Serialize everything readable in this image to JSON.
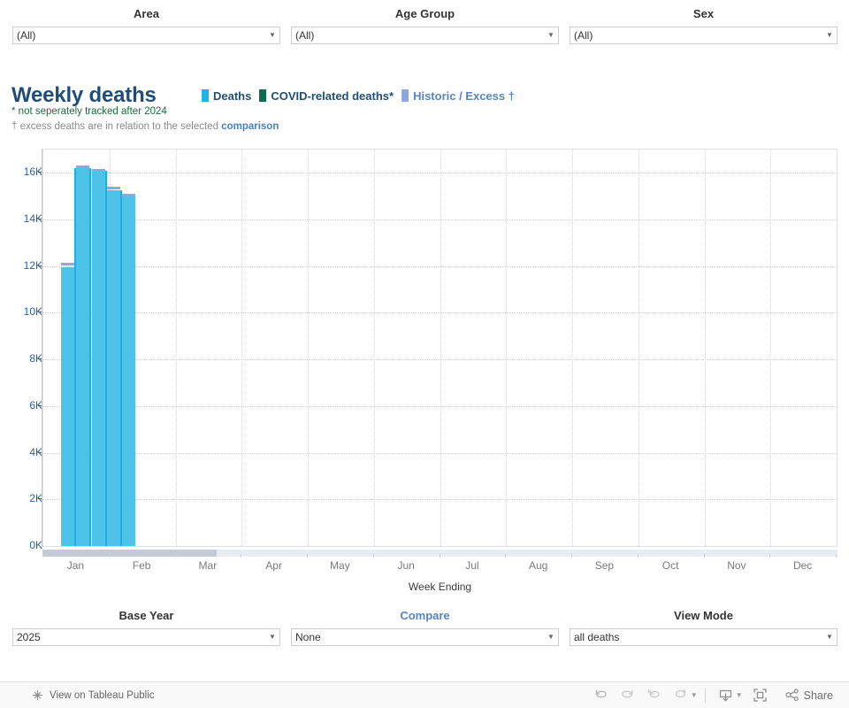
{
  "top_filters": [
    {
      "label": "Area",
      "value": "(All)",
      "label_color": "#333333"
    },
    {
      "label": "Age Group",
      "value": "(All)",
      "label_color": "#333333"
    },
    {
      "label": "Sex",
      "value": "(All)",
      "label_color": "#333333"
    }
  ],
  "bottom_filters": [
    {
      "label": "Base Year",
      "value": "2025",
      "label_color": "#333333"
    },
    {
      "label": "Compare",
      "value": "None",
      "label_color": "#5585c4"
    },
    {
      "label": "View Mode",
      "value": "all deaths",
      "label_color": "#333333"
    }
  ],
  "title": "Weekly deaths",
  "legend": [
    {
      "label": "Deaths",
      "color": "#1eb4e4",
      "text_color": "#1f4e79"
    },
    {
      "label": "COVID-related deaths*",
      "color": "#0d6b4f",
      "text_color": "#1f4e79"
    },
    {
      "label": "Historic / Excess †",
      "color": "#8da8dd",
      "text_color": "#5585c4"
    }
  ],
  "notes": {
    "line1": "* not seperately tracked after 2024",
    "line2_pre": "† excess deaths are in relation to the selected ",
    "line2_link": "comparison"
  },
  "toolbar": {
    "tableau_label": "View on Tableau Public",
    "undo_label": "Undo",
    "redo_label": "Redo",
    "revert_label": "Revert",
    "refresh_label": "Refresh",
    "download_label": "Download",
    "fullscreen_label": "Full Screen",
    "share_label": "Share"
  },
  "chart_data": {
    "type": "bar",
    "title": "Weekly deaths",
    "xlabel": "Week Ending",
    "ylabel": "",
    "ylim": [
      0,
      17000
    ],
    "grid": true,
    "legend_position": "top",
    "ytick_labels": [
      "0K",
      "2K",
      "4K",
      "6K",
      "8K",
      "10K",
      "12K",
      "14K",
      "16K"
    ],
    "ytick_values": [
      0,
      2000,
      4000,
      6000,
      8000,
      10000,
      12000,
      14000,
      16000
    ],
    "xtick_labels": [
      "Jan",
      "Feb",
      "Mar",
      "Apr",
      "May",
      "Jun",
      "Jul",
      "Aug",
      "Sep",
      "Oct",
      "Nov",
      "Dec"
    ],
    "bar_color": "#4ec3ea",
    "bar_separator_color": "#1eb0e0",
    "series": [
      {
        "name": "Deaths",
        "categories": [
          "Jan 4",
          "Jan 11",
          "Jan 18",
          "Jan 25",
          "Feb 1"
        ],
        "values": [
          11950,
          16200,
          16100,
          15250,
          15000
        ]
      },
      {
        "name": "Historic / Excess",
        "categories": [
          "Jan 4",
          "Jan 11",
          "Jan 18",
          "Jan 25",
          "Feb 1"
        ],
        "values": [
          12150,
          16300,
          16150,
          15400,
          15100
        ]
      }
    ],
    "x_fraction_span": 0.0965
  }
}
